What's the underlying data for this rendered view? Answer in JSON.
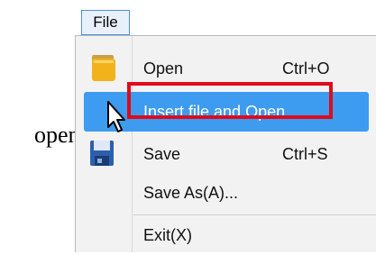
{
  "annotation": {
    "side_text": "open]"
  },
  "menubar": {
    "file_label": "File"
  },
  "menu": {
    "items": [
      {
        "label": "Open",
        "shortcut": "Ctrl+O",
        "icon": "folder-icon"
      },
      {
        "label": "Insert file and Open",
        "shortcut": "",
        "icon": ""
      },
      {
        "label": "Save",
        "shortcut": "Ctrl+S",
        "icon": "floppy-disk-icon"
      },
      {
        "label": "Save As(A)...",
        "shortcut": "",
        "icon": ""
      },
      {
        "label": "Exit(X)",
        "shortcut": "",
        "icon": ""
      }
    ],
    "highlighted_index": 1
  },
  "colors": {
    "highlight": "#3d9bf0",
    "callout_border": "#e00a1a",
    "menu_background": "#f2f2f2"
  }
}
